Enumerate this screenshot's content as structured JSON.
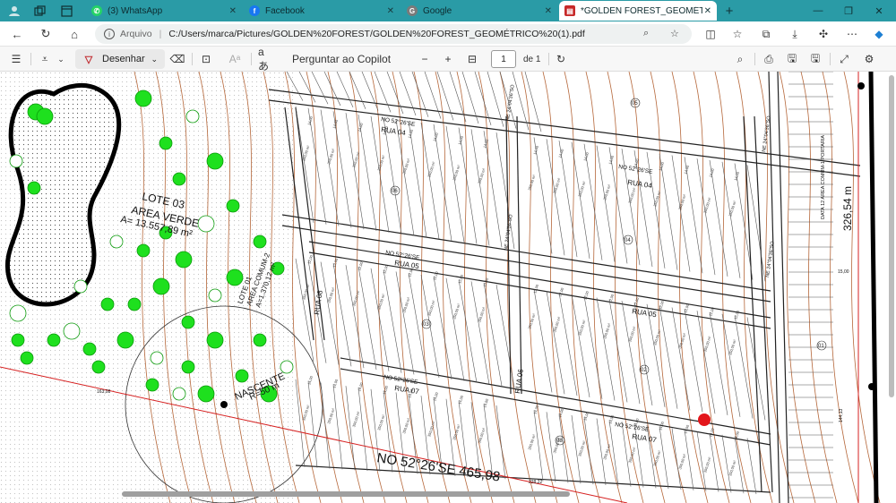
{
  "browser": {
    "tabs": [
      {
        "label": "(3) WhatsApp",
        "icon": "whatsapp-icon",
        "color": "#25d366"
      },
      {
        "label": "Facebook",
        "icon": "facebook-icon",
        "color": "#1877f2"
      },
      {
        "label": "Google",
        "icon": "google-icon",
        "color": "#7a7a7a"
      },
      {
        "label": "*GOLDEN FOREST_GEOMÉTRICO",
        "icon": "pdf-icon",
        "color": "#c62828"
      }
    ],
    "address_prefix": "Arquivo",
    "url": "C:/Users/marca/Pictures/GOLDEN%20FOREST/GOLDEN%20FOREST_GEOMÉTRICO%20(1).pdf",
    "accent": "#2a9ba6"
  },
  "pdf_toolbar": {
    "draw_label": "Desenhar",
    "copilot_label": "Perguntar ao Copilot",
    "page_current": "1",
    "page_total": "de 1"
  },
  "map": {
    "lote_03_title": "LOTE  03",
    "lote_03_sub": "AREA VERDE",
    "lote_03_area": "A= 13.557,89 m²",
    "lote_01_title": "LOTE 01",
    "lote_01_sub": "AREA COMUM-2",
    "lote_01_area": "A=1.370,12 m²",
    "nascente": "NASCENTE",
    "nascente_r": "R=50 m",
    "rua_04_top": "RUA 04",
    "rua_04_right": "RUA 04",
    "rua_05_left": "RUA 05",
    "rua_05_right": "RUA 05",
    "rua_06": "RUA 06",
    "rua_07_left": "RUA 07",
    "rua_07_right": "RUA 07",
    "rua_08": "RUA 08",
    "bearing_1": "NO 52°26'SE",
    "bearing_2": "NO 52°26'SE",
    "bearing_3": "NO 52°26'SE",
    "bearing_4": "NO 52°26'SE",
    "bearing_5": "NO 52°26'SE",
    "bearing_bottom": "NO 52°26'SE 465,98",
    "ne_1": "NE 24°04'36\"SO",
    "ne_2": "NE 24°04'36\"SO",
    "ne_3": "NE 24°04'36\"SO",
    "ne_4": "NE 24°04'36\"SO",
    "edge_length": "326,54 m",
    "dim_163": "163,08",
    "dim_15": "15,00",
    "dim_1441": "144,13",
    "dim_228": "228,22",
    "portaria": "DATA 12 AREA COMUM-1 PORTARIA",
    "marker_05": "05",
    "marker_06": "06",
    "marker_03": "03",
    "marker_04": "04",
    "marker_02": "02",
    "marker_01": "01",
    "marker_08": "08",
    "lot_area_sample": "350,00 m²",
    "lot_dim_sample": "14,00",
    "lot_dim_sample2": "12,00"
  }
}
